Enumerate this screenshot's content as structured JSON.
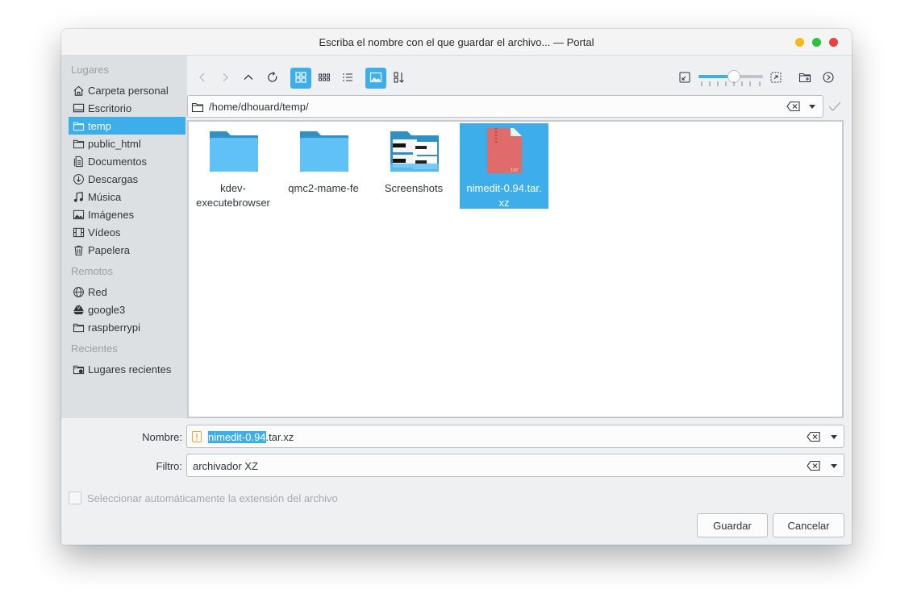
{
  "window": {
    "title": "Escriba el nombre con el que guardar el archivo... — Portal"
  },
  "sidebar": {
    "sections": [
      {
        "label": "Lugares"
      },
      {
        "label": "Remotos"
      },
      {
        "label": "Recientes"
      }
    ],
    "items": [
      {
        "label": "Carpeta personal",
        "icon": "home-icon"
      },
      {
        "label": "Escritorio",
        "icon": "desktop-icon"
      },
      {
        "label": "temp",
        "icon": "folder-icon",
        "active": true
      },
      {
        "label": "public_html",
        "icon": "folder-icon"
      },
      {
        "label": "Documentos",
        "icon": "documents-icon"
      },
      {
        "label": "Descargas",
        "icon": "download-icon"
      },
      {
        "label": "Música",
        "icon": "music-icon"
      },
      {
        "label": "Imágenes",
        "icon": "image-icon"
      },
      {
        "label": "Vídeos",
        "icon": "video-icon"
      },
      {
        "label": "Papelera",
        "icon": "trash-icon"
      },
      {
        "label": "Red",
        "icon": "network-icon"
      },
      {
        "label": "google3",
        "icon": "google-drive-icon"
      },
      {
        "label": "raspberrypi",
        "icon": "folder-icon"
      },
      {
        "label": "Lugares recientes",
        "icon": "recent-folder-icon"
      }
    ]
  },
  "toolbar": {
    "zoom_level": 0.55,
    "view_mode": "icons",
    "preview_enabled": true
  },
  "path": {
    "value": "/home/dhouard/temp/"
  },
  "files": [
    {
      "name": "kdev-executebrowser",
      "label_line1": "kdev-",
      "label_line2": "executebrowser",
      "type": "folder"
    },
    {
      "name": "qmc2-mame-fe",
      "label_line1": "qmc2-mame-fe",
      "label_line2": "",
      "type": "folder"
    },
    {
      "name": "Screenshots",
      "label_line1": "Screenshots",
      "label_line2": "",
      "type": "folder-preview"
    },
    {
      "name": "nimedit-0.94.tar.xz",
      "label_line1": "nimedit-0.94.tar.",
      "label_line2": "xz",
      "type": "archive",
      "badge": "tar",
      "selected": true
    }
  ],
  "form": {
    "name_label": "Nombre:",
    "name_selected": "nimedit-0.94",
    "name_rest": ".tar.xz",
    "filter_label": "Filtro:",
    "filter_value": "archivador XZ",
    "auto_extension_label": "Seleccionar automáticamente la extensión del archivo",
    "auto_extension_checked": false
  },
  "buttons": {
    "save": "Guardar",
    "cancel": "Cancelar"
  },
  "colors": {
    "accent": "#3daee9",
    "sidebar_bg": "#dde0e3",
    "window_bg": "#eff0f1"
  }
}
